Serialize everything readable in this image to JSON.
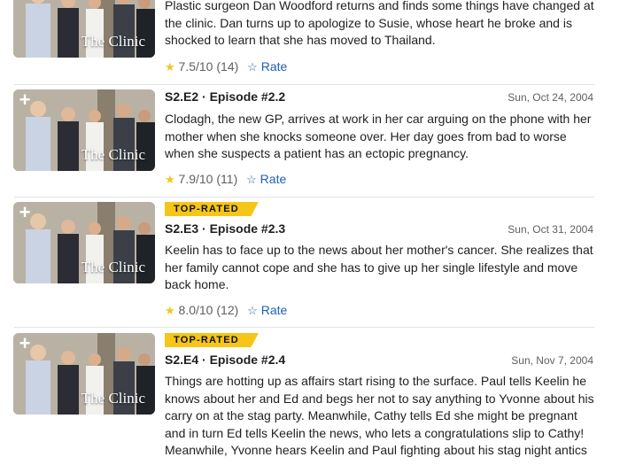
{
  "episodes": [
    {
      "badge": "",
      "code": "",
      "date": "",
      "thumb_label": "The Clinic",
      "description": "Plastic surgeon Dan Woodford returns and finds some things have changed at the clinic. Dan turns up to apologize to Susie, whose heart he broke and is shocked to learn that she has moved to Thailand.",
      "rating": "7.5/10",
      "votes": "(14)",
      "rate_label": "Rate"
    },
    {
      "badge": "",
      "code": "S2.E2 · Episode #2.2",
      "date": "Sun, Oct 24, 2004",
      "thumb_label": "The Clinic",
      "description": "Clodagh, the new GP, arrives at work in her car arguing on the phone with her mother when she knocks someone over. Her day goes from bad to worse when she suspects a patient has an ectopic pregnancy.",
      "rating": "7.9/10",
      "votes": "(11)",
      "rate_label": "Rate"
    },
    {
      "badge": "TOP-RATED",
      "code": "S2.E3 · Episode #2.3",
      "date": "Sun, Oct 31, 2004",
      "thumb_label": "The Clinic",
      "description": "Keelin has to face up to the news about her mother's cancer. She realizes that her family cannot cope and she has to give up her single lifestyle and move back home.",
      "rating": "8.0/10",
      "votes": "(12)",
      "rate_label": "Rate"
    },
    {
      "badge": "TOP-RATED",
      "code": "S2.E4 · Episode #2.4",
      "date": "Sun, Nov 7, 2004",
      "thumb_label": "The Clinic",
      "description": "Things are hotting up as affairs start rising to the surface. Paul tells Keelin he knows about her and Ed and begs her not to say anything to Yvonne about his carry on at the stag party. Meanwhile, Cathy tells Ed she might be pregnant and in turn Ed tells Keelin the news, who lets a congratulations slip to Cathy! Meanwhile, Yvonne hears Keelin and Paul fighting about his stag night antics",
      "rating": "",
      "votes": "",
      "rate_label": ""
    }
  ],
  "icons": {
    "plus": "+",
    "star": "★",
    "star_outline": "☆"
  }
}
